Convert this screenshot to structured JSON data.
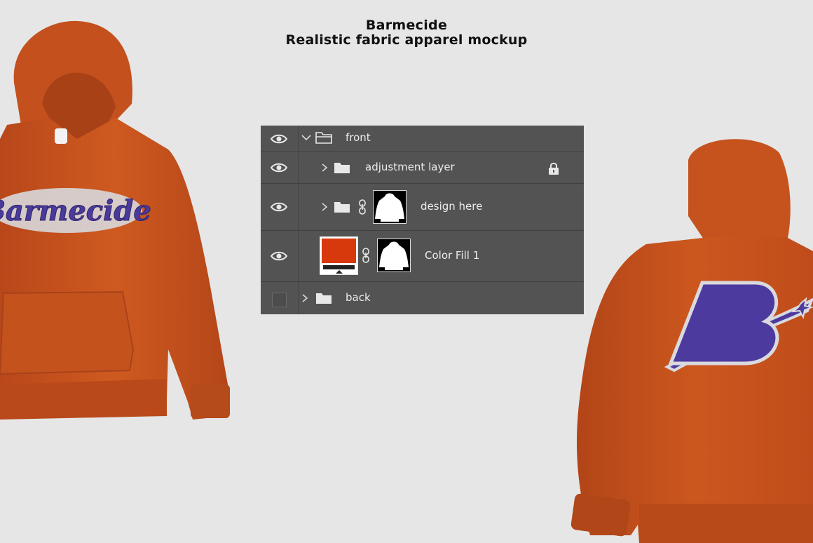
{
  "header": {
    "title": "Barmecide",
    "subtitle": "Realistic fabric apparel mockup"
  },
  "front_hoodie": {
    "chest_text": "Barmecide",
    "fabric_color": "#c9531b",
    "text_color": "#4a3a99"
  },
  "back_hoodie": {
    "logo_letter": "B",
    "fabric_color": "#c9531b",
    "logo_color": "#4c3a9e"
  },
  "layers_panel": {
    "background": "#535353",
    "layers": [
      {
        "name": "front",
        "visible": true,
        "type": "group",
        "expanded": true
      },
      {
        "name": "adjustment layer",
        "visible": true,
        "type": "group",
        "locked": true
      },
      {
        "name": "design here",
        "visible": true,
        "type": "group",
        "has_mask": true
      },
      {
        "name": "Color Fill 1",
        "visible": true,
        "type": "fill",
        "fill_color": "#d8390c",
        "has_mask": true
      },
      {
        "name": "back",
        "visible": false,
        "type": "group"
      }
    ]
  },
  "icons": {
    "eye": "eye-icon",
    "folder": "folder-icon",
    "lock": "lock-icon",
    "link": "link-icon",
    "chevron": "chevron-icon"
  }
}
